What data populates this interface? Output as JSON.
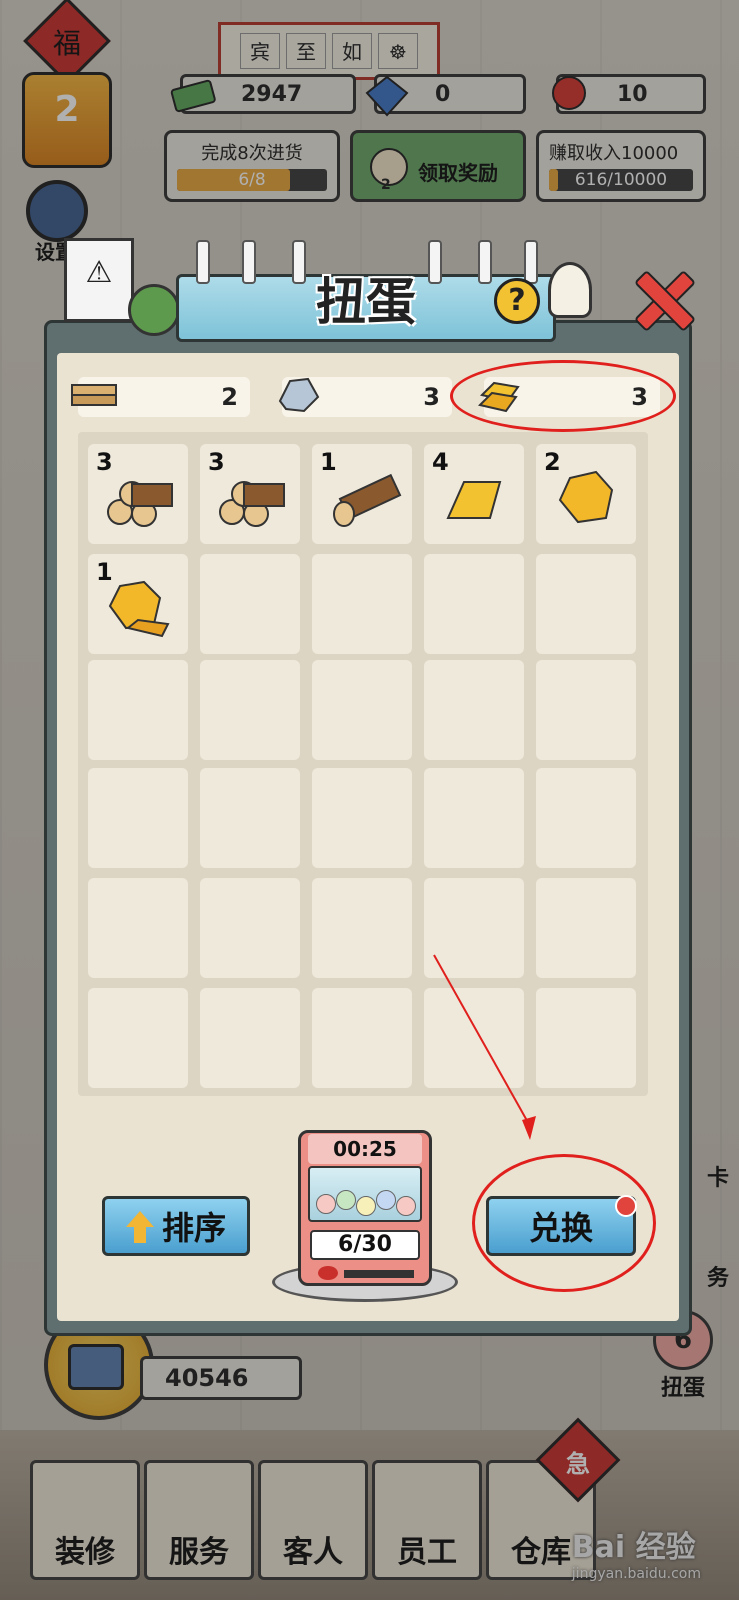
{
  "top_sign": [
    "宾",
    "至",
    "如",
    ""
  ],
  "fu_badge": {
    "char": "福",
    "level": "2"
  },
  "resources": [
    {
      "icon": "cash-icon",
      "value": "2947"
    },
    {
      "icon": "diamond-icon",
      "value": "0"
    },
    {
      "icon": "rose-icon",
      "value": "10"
    }
  ],
  "tasks": [
    {
      "title": "完成8次进货",
      "progress": "6/8",
      "fraction": 0.75
    },
    {
      "title": "领取奖励",
      "badge": "2"
    },
    {
      "title": "赚取收入10000",
      "progress": "616/10000",
      "fraction": 0.06
    }
  ],
  "side_left": {
    "settings_label": "设置"
  },
  "side_right": {
    "card_label": "卡",
    "task_label": "务",
    "gacha_badge": "6",
    "gacha_label": "扭蛋"
  },
  "cash_counter": "40546",
  "bottom_nav": [
    {
      "label": "装修"
    },
    {
      "label": "服务"
    },
    {
      "label": "客人"
    },
    {
      "label": "员工"
    },
    {
      "label": "仓库"
    }
  ],
  "urgent_badge": "急",
  "watermark": {
    "brand": "Bai 经验",
    "url": "jingyan.baidu.com"
  },
  "dialog": {
    "title": "扭蛋",
    "help": "?",
    "materials": [
      {
        "icon": "wood-plank-icon",
        "value": "2"
      },
      {
        "icon": "stone-icon",
        "value": "3"
      },
      {
        "icon": "gold-bar-icon",
        "value": "3"
      }
    ],
    "items": [
      {
        "icon": "log-pile-icon",
        "count": "3"
      },
      {
        "icon": "log-pile-icon",
        "count": "3"
      },
      {
        "icon": "log-icon",
        "count": "1"
      },
      {
        "icon": "gold-bar-icon",
        "count": "4"
      },
      {
        "icon": "gold-nugget-icon",
        "count": "2"
      },
      {
        "icon": "gold-nugget-icon",
        "count": "1"
      }
    ],
    "sort_label": "排序",
    "exchange_label": "兑换",
    "machine": {
      "timer": "00:25",
      "counter": "6/30"
    }
  },
  "colors": {
    "accent": "#4a9fcf",
    "highlight": "#e0201d",
    "panel": "#ebe3d2"
  }
}
